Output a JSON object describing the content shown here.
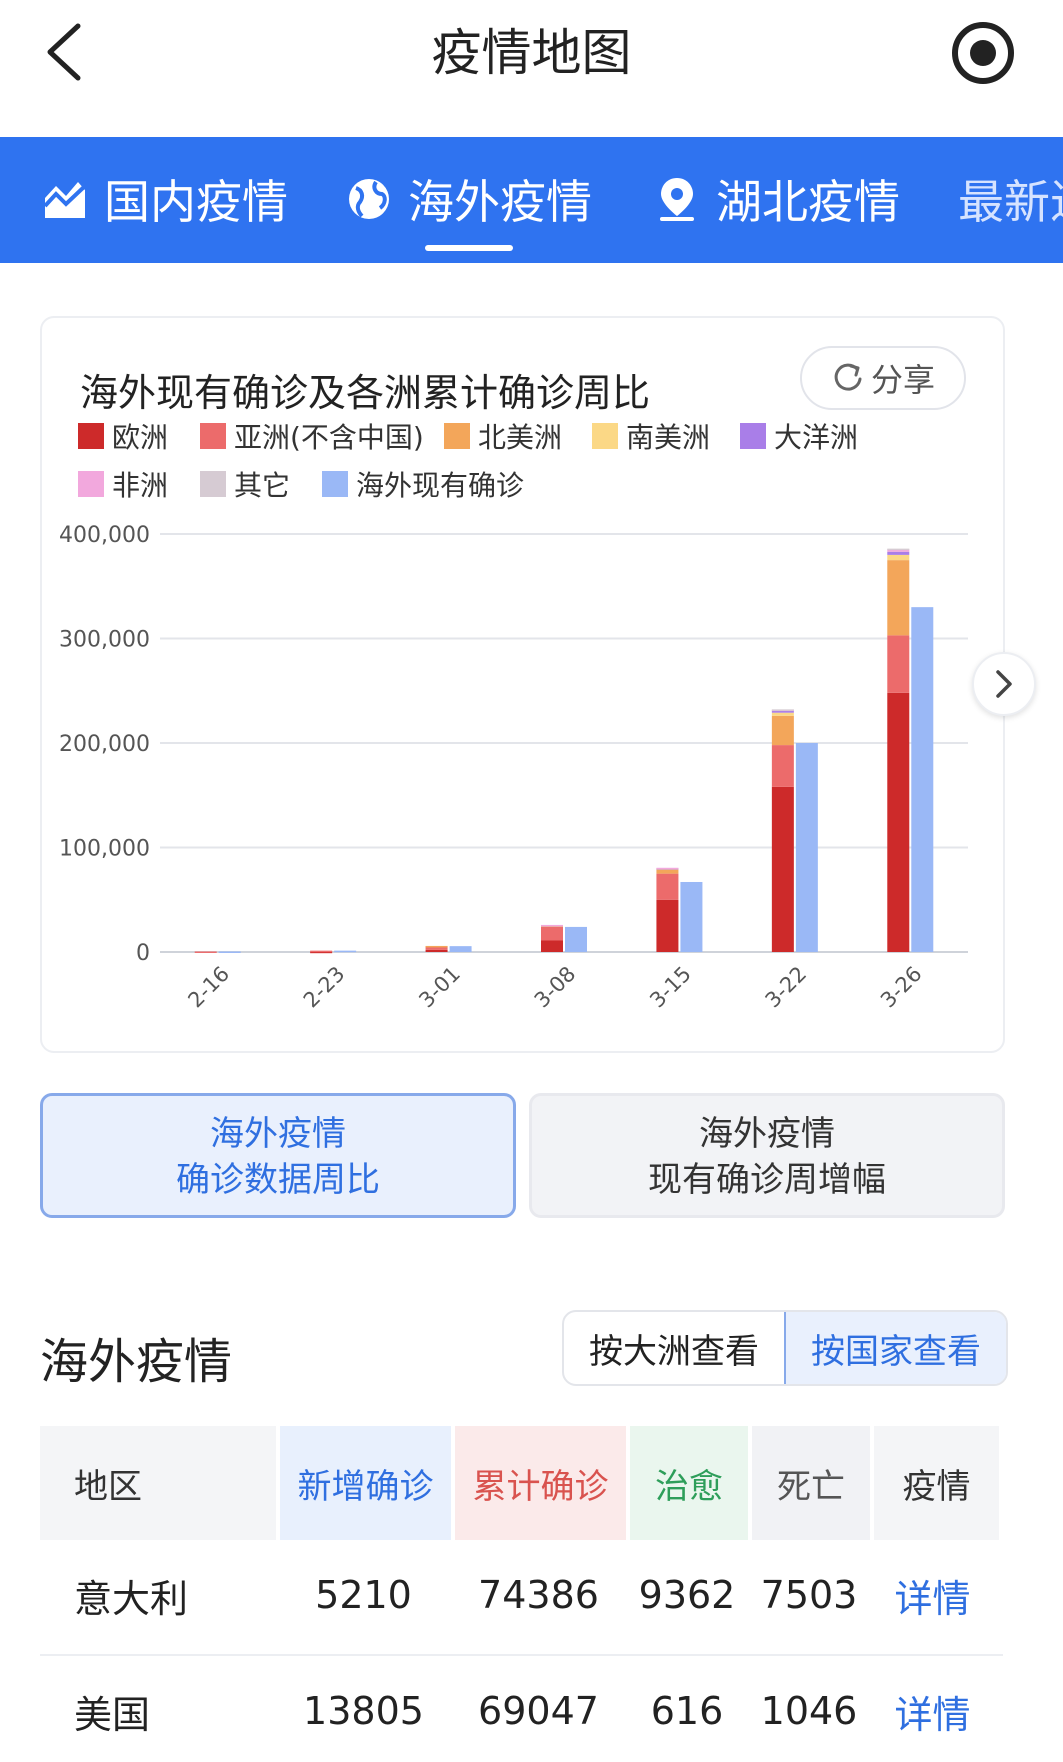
{
  "header": {
    "title": "疫情地图"
  },
  "tabs": [
    {
      "label": "国内疫情",
      "icon": "chart-line-icon"
    },
    {
      "label": "海外疫情",
      "icon": "globe-icon"
    },
    {
      "label": "湖北疫情",
      "icon": "location-pin-icon"
    },
    {
      "label": "最新进"
    }
  ],
  "card": {
    "title": "海外现有确诊及各洲累计确诊周比",
    "share_label": "分享"
  },
  "chart_data": {
    "type": "bar",
    "title": "海外现有确诊及各洲累计确诊周比",
    "categories": [
      "2-16",
      "2-23",
      "3-01",
      "3-08",
      "3-15",
      "3-22",
      "3-26"
    ],
    "yticks": [
      "0",
      "100,000",
      "200,000",
      "300,000",
      "400,000"
    ],
    "ylim": [
      0,
      400000
    ],
    "grid": true,
    "legend_position": "top",
    "stacked_series": [
      {
        "name": "欧洲",
        "color": "#cd2a2a",
        "values": [
          0,
          300,
          2000,
          11000,
          50000,
          158000,
          248000
        ]
      },
      {
        "name": "亚洲(不含中国)",
        "color": "#ec6b6b",
        "values": [
          500,
          1000,
          3500,
          13000,
          25000,
          40000,
          55000
        ]
      },
      {
        "name": "北美洲",
        "color": "#f3a65a",
        "values": [
          0,
          0,
          300,
          1500,
          4500,
          28000,
          72000
        ]
      },
      {
        "name": "南美洲",
        "color": "#fbd886",
        "values": [
          0,
          0,
          0,
          200,
          500,
          3000,
          5000
        ]
      },
      {
        "name": "大洋洲",
        "color": "#a97ee8",
        "values": [
          0,
          0,
          0,
          100,
          300,
          1800,
          3000
        ]
      },
      {
        "name": "非洲",
        "color": "#f2a8dd",
        "values": [
          0,
          0,
          0,
          100,
          300,
          1200,
          2500
        ]
      },
      {
        "name": "其它",
        "color": "#d6cbd3",
        "values": [
          0,
          0,
          0,
          0,
          0,
          200,
          500
        ]
      }
    ],
    "series": [
      {
        "name": "海外现有确诊",
        "color": "#9ab8f6",
        "values": [
          500,
          1300,
          5600,
          24000,
          67000,
          200000,
          330000
        ]
      }
    ]
  },
  "toggle": {
    "active": {
      "line1": "海外疫情",
      "line2": "确诊数据周比"
    },
    "inactive": {
      "line1": "海外疫情",
      "line2": "现有确诊周增幅"
    }
  },
  "section": {
    "title": "海外疫情",
    "seg_continent": "按大洲查看",
    "seg_country": "按国家查看"
  },
  "table": {
    "headers": [
      "地区",
      "新增确诊",
      "累计确诊",
      "治愈",
      "死亡",
      "疫情"
    ],
    "rows": [
      {
        "region": "意大利",
        "new": "5210",
        "total": "74386",
        "cured": "9362",
        "dead": "7503",
        "detail": "详情"
      },
      {
        "region": "美国",
        "new": "13805",
        "total": "69047",
        "cured": "616",
        "dead": "1046",
        "detail": "详情"
      }
    ]
  }
}
